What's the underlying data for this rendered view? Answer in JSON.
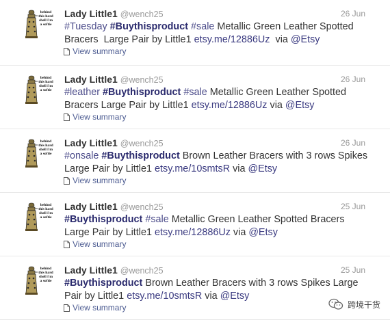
{
  "tweets": [
    {
      "name": "Lady Little1",
      "handle": "@wench25",
      "date": "26 Jun",
      "segments": [
        {
          "t": "#Tuesday ",
          "k": "tag"
        },
        {
          "t": "#Buythisproduct",
          "k": "strong-tag"
        },
        {
          "t": " ",
          "k": "text"
        },
        {
          "t": "#sale",
          "k": "tag"
        },
        {
          "t": " Metallic Green Leather Spotted\nBracers  Large Pair by Little1 ",
          "k": "text"
        },
        {
          "t": "etsy.me/12886Uz",
          "k": "link"
        },
        {
          "t": "  via ",
          "k": "text"
        },
        {
          "t": "@Etsy",
          "k": "link"
        }
      ],
      "summary": "View summary"
    },
    {
      "name": "Lady Little1",
      "handle": "@wench25",
      "date": "26 Jun",
      "segments": [
        {
          "t": "#leather ",
          "k": "tag"
        },
        {
          "t": "#Buythisproduct",
          "k": "strong-tag"
        },
        {
          "t": " ",
          "k": "text"
        },
        {
          "t": "#sale",
          "k": "tag"
        },
        {
          "t": " Metallic Green Leather Spotted\nBracers Large Pair by Little1 ",
          "k": "text"
        },
        {
          "t": "etsy.me/12886Uz",
          "k": "link"
        },
        {
          "t": " via ",
          "k": "text"
        },
        {
          "t": "@Etsy",
          "k": "link"
        }
      ],
      "summary": "View summary"
    },
    {
      "name": "Lady Little1",
      "handle": "@wench25",
      "date": "26 Jun",
      "segments": [
        {
          "t": "#onsale ",
          "k": "tag"
        },
        {
          "t": "#Buythisproduct",
          "k": "strong-tag"
        },
        {
          "t": " Brown Leather Bracers with 3 rows Spikes\nLarge Pair by Little1 ",
          "k": "text"
        },
        {
          "t": "etsy.me/10smtsR",
          "k": "link"
        },
        {
          "t": " via ",
          "k": "text"
        },
        {
          "t": "@Etsy",
          "k": "link"
        }
      ],
      "summary": "View summary"
    },
    {
      "name": "Lady Little1",
      "handle": "@wench25",
      "date": "25 Jun",
      "segments": [
        {
          "t": "#Buythisproduct",
          "k": "strong-tag"
        },
        {
          "t": " ",
          "k": "text"
        },
        {
          "t": "#sale",
          "k": "tag"
        },
        {
          "t": " Metallic Green Leather Spotted Bracers\nLarge Pair by Little1 ",
          "k": "text"
        },
        {
          "t": "etsy.me/12886Uz",
          "k": "link"
        },
        {
          "t": " via ",
          "k": "text"
        },
        {
          "t": "@Etsy",
          "k": "link"
        }
      ],
      "summary": "View summary"
    },
    {
      "name": "Lady Little1",
      "handle": "@wench25",
      "date": "25 Jun",
      "segments": [
        {
          "t": "#Buythisproduct",
          "k": "strong-tag"
        },
        {
          "t": " Brown Leather Bracers with 3 rows Spikes Large\nPair by Little1 ",
          "k": "text"
        },
        {
          "t": "etsy.me/10smtsR",
          "k": "link"
        },
        {
          "t": " via ",
          "k": "text"
        },
        {
          "t": "@Etsy",
          "k": "link"
        }
      ],
      "summary": "View summary"
    }
  ],
  "avatar_caption": "behind this hard shell i'm a softie",
  "watermark": "跨境干货",
  "icons": {
    "avatar": "dalek-avatar-icon",
    "summary": "document-icon",
    "watermark": "wechat-icon"
  },
  "colors": {
    "link": "#3a3a80",
    "muted": "#999999",
    "summary": "#4c5b91"
  }
}
